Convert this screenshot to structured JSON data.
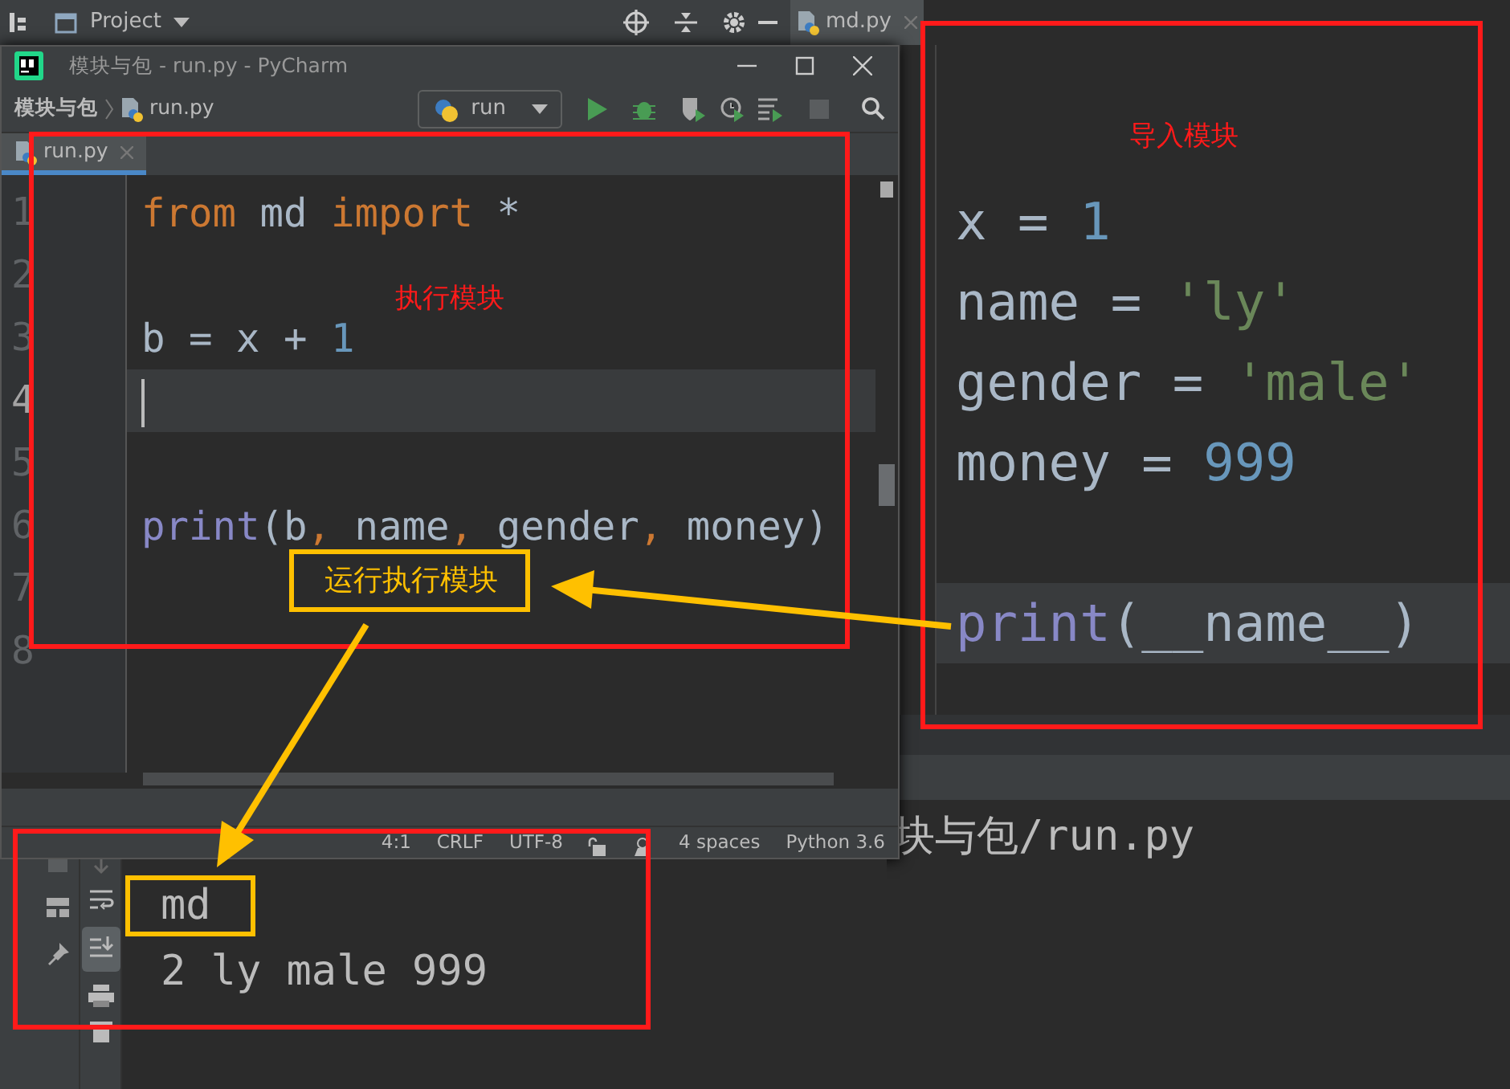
{
  "back_window": {
    "project_label": "Project",
    "tab": {
      "label": "md.py"
    },
    "annotation_label": "导入模块",
    "code_lines": [
      {
        "current": false,
        "tokens": [
          {
            "text": "x",
            "kind": "ident"
          },
          {
            "text": " = ",
            "kind": "op"
          },
          {
            "text": "1",
            "kind": "number"
          }
        ]
      },
      {
        "current": false,
        "tokens": [
          {
            "text": "name",
            "kind": "ident"
          },
          {
            "text": " = ",
            "kind": "op"
          },
          {
            "text": "'ly'",
            "kind": "string"
          }
        ]
      },
      {
        "current": false,
        "tokens": [
          {
            "text": "gender",
            "kind": "ident"
          },
          {
            "text": " = ",
            "kind": "op"
          },
          {
            "text": "'male'",
            "kind": "string"
          }
        ]
      },
      {
        "current": false,
        "tokens": [
          {
            "text": "money",
            "kind": "ident"
          },
          {
            "text": " = ",
            "kind": "op"
          },
          {
            "text": "999",
            "kind": "number"
          }
        ]
      },
      {
        "current": false
      },
      {
        "current": true,
        "tokens": [
          {
            "text": "print",
            "kind": "builtin"
          },
          {
            "text": "(__name__)",
            "kind": "ident"
          }
        ]
      }
    ],
    "console_text": "块与包/run.py"
  },
  "front_window": {
    "title": "模块与包 - run.py - PyCharm",
    "breadcrumbs": [
      "模块与包",
      "run.py"
    ],
    "run_config": "run",
    "tab": {
      "label": "run.py"
    },
    "line_numbers": [
      "1",
      "2",
      "3",
      "4",
      "5",
      "6",
      "7",
      "8"
    ],
    "code_lines": [
      {
        "current": false,
        "tokens": [
          {
            "text": "from",
            "kind": "keyword"
          },
          {
            "text": " md ",
            "kind": "ident"
          },
          {
            "text": "import",
            "kind": "keyword"
          },
          {
            "text": " *",
            "kind": "ident"
          }
        ]
      },
      {
        "current": false
      },
      {
        "current": false,
        "tokens": [
          {
            "text": "b = x + ",
            "kind": "ident"
          },
          {
            "text": "1",
            "kind": "number"
          }
        ]
      },
      {
        "current": true
      },
      {
        "current": false
      },
      {
        "current": false,
        "tokens": [
          {
            "text": "print",
            "kind": "builtin"
          },
          {
            "text": "(b",
            "kind": "ident"
          },
          {
            "text": ",",
            "kind": "keyword"
          },
          {
            "text": " name",
            "kind": "ident"
          },
          {
            "text": ",",
            "kind": "keyword"
          },
          {
            "text": " gender",
            "kind": "ident"
          },
          {
            "text": ",",
            "kind": "keyword"
          },
          {
            "text": " money)",
            "kind": "ident"
          }
        ]
      },
      {
        "current": false
      },
      {
        "current": false
      }
    ],
    "status_bar": [
      "4:1",
      "CRLF",
      "UTF-8",
      "4 spaces",
      "Python 3.6"
    ]
  },
  "console": {
    "scroll_to_end_on": true,
    "lines": [
      {
        "text": "md",
        "highlighted": true
      },
      {
        "text": "2 ly male 999",
        "highlighted": false
      }
    ]
  },
  "annotations": {
    "editor_label": "执行模块",
    "callout": "运行执行模块"
  }
}
